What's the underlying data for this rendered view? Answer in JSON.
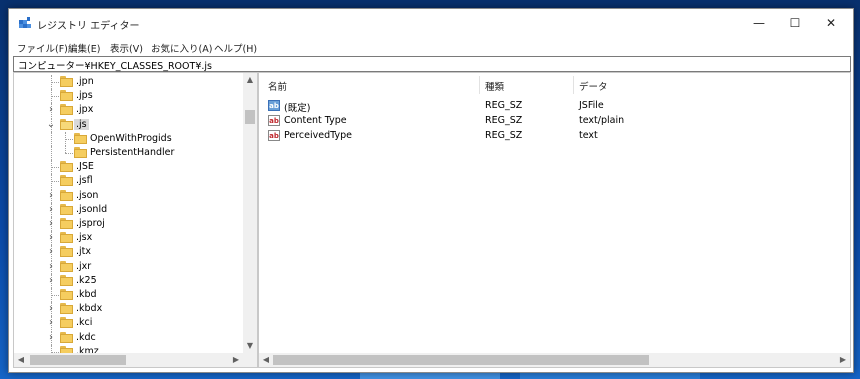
{
  "window": {
    "title": "レジストリ エディター",
    "caption_buttons": {
      "minimize": "—",
      "maximize": "☐",
      "close": "✕"
    }
  },
  "menu": [
    "ファイル(F)",
    "編集(E)",
    "表示(V)",
    "お気に入り(A)",
    "ヘルプ(H)"
  ],
  "address": "コンピューター¥HKEY_CLASSES_ROOT¥.js",
  "tree": {
    "items": [
      {
        "label": ".jpn",
        "expander": ""
      },
      {
        "label": ".jps",
        "expander": ""
      },
      {
        "label": ".jpx",
        "expander": ">"
      },
      {
        "label": ".js",
        "expander": "v",
        "selected": true
      },
      {
        "label": "OpenWithProgids",
        "expander": "",
        "child": true
      },
      {
        "label": "PersistentHandler",
        "expander": "",
        "child": true
      },
      {
        "label": ".JSE",
        "expander": ""
      },
      {
        "label": ".jsfl",
        "expander": ""
      },
      {
        "label": ".json",
        "expander": ">"
      },
      {
        "label": ".jsonld",
        "expander": ">"
      },
      {
        "label": ".jsproj",
        "expander": ">"
      },
      {
        "label": ".jsx",
        "expander": ">"
      },
      {
        "label": ".jtx",
        "expander": ">"
      },
      {
        "label": ".jxr",
        "expander": ">"
      },
      {
        "label": ".k25",
        "expander": ">"
      },
      {
        "label": ".kbd",
        "expander": ""
      },
      {
        "label": ".kbdx",
        "expander": ">"
      },
      {
        "label": ".kci",
        "expander": ">"
      },
      {
        "label": ".kdc",
        "expander": ">"
      },
      {
        "label": ".kmz",
        "expander": ""
      }
    ]
  },
  "list": {
    "columns": [
      "名前",
      "種類",
      "データ"
    ],
    "rows": [
      {
        "name": "(既定)",
        "type": "REG_SZ",
        "data": "JSFile",
        "icon": "ab-default-icon"
      },
      {
        "name": "Content Type",
        "type": "REG_SZ",
        "data": "text/plain",
        "icon": "ab-string-icon"
      },
      {
        "name": "PerceivedType",
        "type": "REG_SZ",
        "data": "text",
        "icon": "ab-string-icon"
      }
    ]
  },
  "icon_text": "ab",
  "scroll_glyphs": {
    "up": "▲",
    "down": "▼",
    "left": "◀",
    "right": "▶"
  },
  "colors": {
    "selection": "#d9d9d9",
    "folder": "#f5cd5f",
    "string_icon": "#c0282d"
  }
}
